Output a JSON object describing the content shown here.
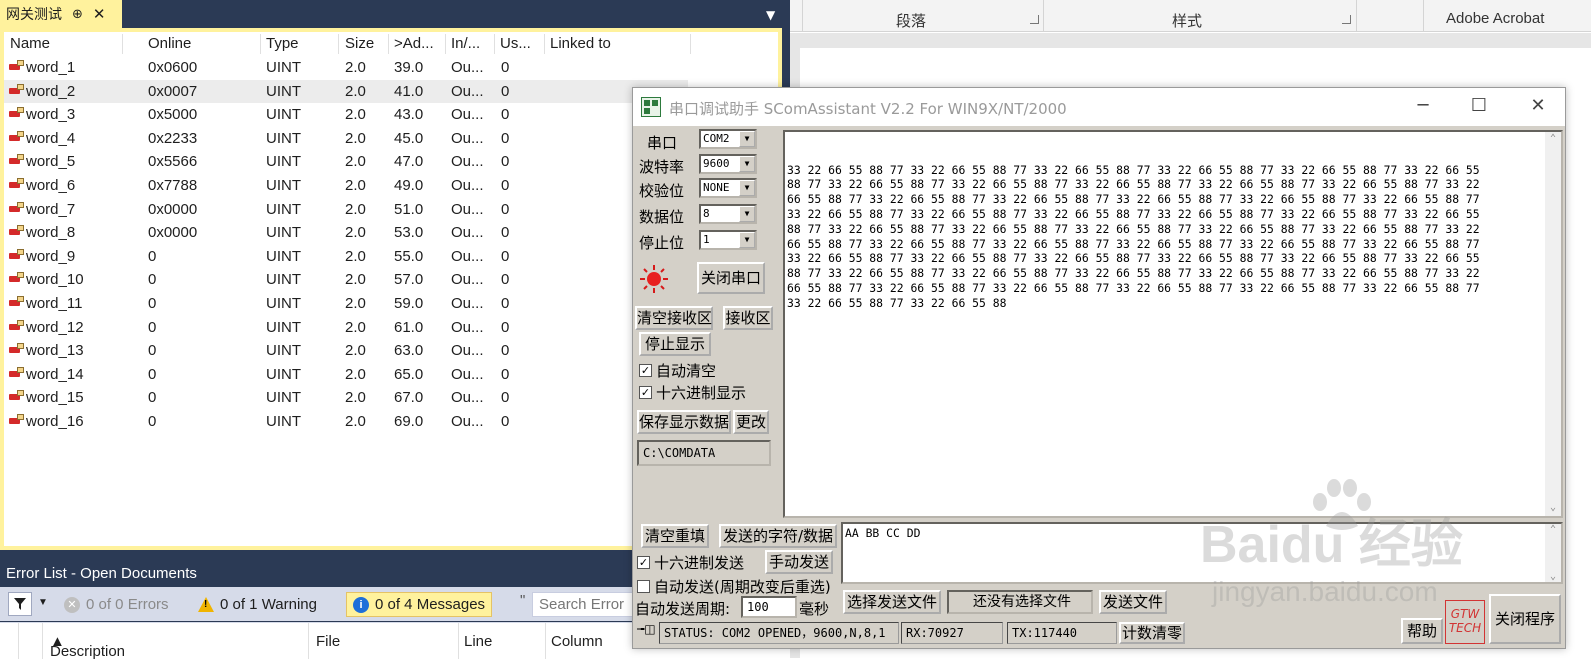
{
  "vs": {
    "tab_title": "网关测试",
    "tab_pin": "⊕",
    "tab_close": "✕",
    "columns": [
      "Name",
      "Online",
      "Type",
      "Size",
      ">Ad...",
      "In/...",
      "Us...",
      "Linked to"
    ],
    "rows": [
      {
        "name": "word_1",
        "online": "0x0600",
        "type": "UINT",
        "size": "2.0",
        "addr": "39.0",
        "inout": "Ou...",
        "user": "0"
      },
      {
        "name": "word_2",
        "online": "0x0007",
        "type": "UINT",
        "size": "2.0",
        "addr": "41.0",
        "inout": "Ou...",
        "user": "0"
      },
      {
        "name": "word_3",
        "online": "0x5000",
        "type": "UINT",
        "size": "2.0",
        "addr": "43.0",
        "inout": "Ou...",
        "user": "0"
      },
      {
        "name": "word_4",
        "online": "0x2233",
        "type": "UINT",
        "size": "2.0",
        "addr": "45.0",
        "inout": "Ou...",
        "user": "0"
      },
      {
        "name": "word_5",
        "online": "0x5566",
        "type": "UINT",
        "size": "2.0",
        "addr": "47.0",
        "inout": "Ou...",
        "user": "0"
      },
      {
        "name": "word_6",
        "online": "0x7788",
        "type": "UINT",
        "size": "2.0",
        "addr": "49.0",
        "inout": "Ou...",
        "user": "0"
      },
      {
        "name": "word_7",
        "online": "0x0000",
        "type": "UINT",
        "size": "2.0",
        "addr": "51.0",
        "inout": "Ou...",
        "user": "0"
      },
      {
        "name": "word_8",
        "online": "0x0000",
        "type": "UINT",
        "size": "2.0",
        "addr": "53.0",
        "inout": "Ou...",
        "user": "0"
      },
      {
        "name": "word_9",
        "online": "0",
        "type": "UINT",
        "size": "2.0",
        "addr": "55.0",
        "inout": "Ou...",
        "user": "0"
      },
      {
        "name": "word_10",
        "online": "0",
        "type": "UINT",
        "size": "2.0",
        "addr": "57.0",
        "inout": "Ou...",
        "user": "0"
      },
      {
        "name": "word_11",
        "online": "0",
        "type": "UINT",
        "size": "2.0",
        "addr": "59.0",
        "inout": "Ou...",
        "user": "0"
      },
      {
        "name": "word_12",
        "online": "0",
        "type": "UINT",
        "size": "2.0",
        "addr": "61.0",
        "inout": "Ou...",
        "user": "0"
      },
      {
        "name": "word_13",
        "online": "0",
        "type": "UINT",
        "size": "2.0",
        "addr": "63.0",
        "inout": "Ou...",
        "user": "0"
      },
      {
        "name": "word_14",
        "online": "0",
        "type": "UINT",
        "size": "2.0",
        "addr": "65.0",
        "inout": "Ou...",
        "user": "0"
      },
      {
        "name": "word_15",
        "online": "0",
        "type": "UINT",
        "size": "2.0",
        "addr": "67.0",
        "inout": "Ou...",
        "user": "0"
      },
      {
        "name": "word_16",
        "online": "0",
        "type": "UINT",
        "size": "2.0",
        "addr": "69.0",
        "inout": "Ou...",
        "user": "0"
      }
    ],
    "error_list": {
      "title": "Error List - Open Documents",
      "errors": "0 of 0 Errors",
      "warnings": "0 of 1 Warning",
      "messages": "0 of 4 Messages",
      "search_placeholder": "Search Error",
      "columns": [
        "Description",
        "File",
        "Line",
        "Column"
      ]
    }
  },
  "ribbon": {
    "groups": [
      "段落",
      "样式",
      "Adobe Acrobat"
    ]
  },
  "serial": {
    "title": "串口调试助手 SComAssistant V2.2 For WIN9X/NT/2000",
    "labels": {
      "port": "串口",
      "baud": "波特率",
      "parity": "校验位",
      "databits": "数据位",
      "stopbits": "停止位"
    },
    "values": {
      "port": "COM2",
      "baud": "9600",
      "parity": "NONE",
      "databits": "8",
      "stopbits": "1"
    },
    "buttons": {
      "close_port": "关闭串口",
      "clear_recv": "清空接收区",
      "recv_area": "接收区",
      "stop_display": "停止显示",
      "save_data": "保存显示数据",
      "change": "更改",
      "clear_refill": "清空重填",
      "send_chars": "发送的字符/数据",
      "manual_send": "手动发送",
      "choose_file": "选择发送文件",
      "send_file": "发送文件",
      "reset_count": "计数清零",
      "help": "帮助",
      "close_program": "关闭程序"
    },
    "checks": {
      "auto_clear": "自动清空",
      "hex_display": "十六进制显示",
      "hex_send": "十六进制发送",
      "auto_send": "自动发送(周期改变后重选)"
    },
    "save_path": "C:\\COMDATA",
    "period_label": "自动发送周期:",
    "period_value": "100",
    "period_unit": "毫秒",
    "no_file": "还没有选择文件",
    "send_text": "AA BB CC DD",
    "status": "STATUS: COM2 OPENED，9600,N,8,1",
    "rx": "RX:70927",
    "tx": "TX:117440",
    "logo_text": "GTW TECH",
    "recv_lines": [
      "33 22 66 55 88 77 33 22 66 55 88 77 33 22 66 55 88 77 33 22 66 55 88 77 33 22 66 55 88 77 33 22 66 55",
      "88 77 33 22 66 55 88 77 33 22 66 55 88 77 33 22 66 55 88 77 33 22 66 55 88 77 33 22 66 55 88 77 33 22",
      "66 55 88 77 33 22 66 55 88 77 33 22 66 55 88 77 33 22 66 55 88 77 33 22 66 55 88 77 33 22 66 55 88 77",
      "33 22 66 55 88 77 33 22 66 55 88 77 33 22 66 55 88 77 33 22 66 55 88 77 33 22 66 55 88 77 33 22 66 55",
      "88 77 33 22 66 55 88 77 33 22 66 55 88 77 33 22 66 55 88 77 33 22 66 55 88 77 33 22 66 55 88 77 33 22",
      "66 55 88 77 33 22 66 55 88 77 33 22 66 55 88 77 33 22 66 55 88 77 33 22 66 55 88 77 33 22 66 55 88 77",
      "33 22 66 55 88 77 33 22 66 55 88 77 33 22 66 55 88 77 33 22 66 55 88 77 33 22 66 55 88 77 33 22 66 55",
      "88 77 33 22 66 55 88 77 33 22 66 55 88 77 33 22 66 55 88 77 33 22 66 55 88 77 33 22 66 55 88 77 33 22",
      "66 55 88 77 33 22 66 55 88 77 33 22 66 55 88 77 33 22 66 55 88 77 33 22 66 55 88 77 33 22 66 55 88 77",
      "33 22 66 55 88 77 33 22 66 55 88"
    ]
  },
  "watermark": {
    "brand": "Baidu 经验",
    "url": "jingyan.baidu.com"
  }
}
